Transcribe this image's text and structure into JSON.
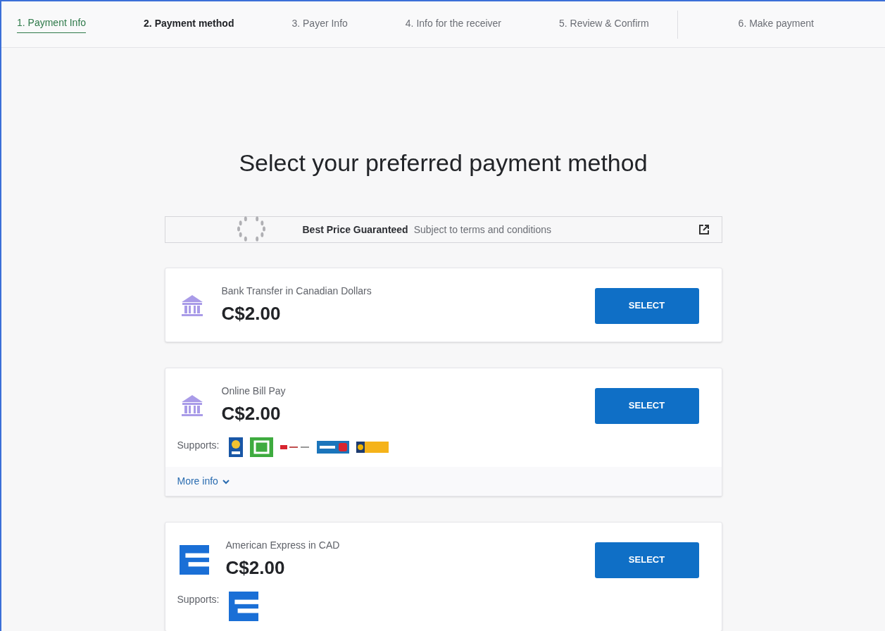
{
  "steps": [
    {
      "label": "1. Payment Info",
      "selected": false,
      "completed": true
    },
    {
      "label": "2. Payment method",
      "selected": true,
      "completed": false
    },
    {
      "label": "3. Payer Info",
      "selected": false,
      "completed": false
    },
    {
      "label": "4. Info for the receiver",
      "selected": false,
      "completed": false
    },
    {
      "label": "5. Review & Confirm",
      "selected": false,
      "completed": false
    },
    {
      "label": "6. Make payment",
      "selected": false,
      "completed": false
    }
  ],
  "title": "Select your preferred payment method",
  "banner": {
    "headline": "Best Price Guaranteed",
    "text": "Subject to terms and conditions"
  },
  "methods": [
    {
      "kind": "bank",
      "name": "Bank Transfer in Canadian Dollars",
      "price": "C$2.00",
      "button": "SELECT"
    },
    {
      "kind": "bank",
      "name": "Online Bill Pay",
      "price": "C$2.00",
      "button": "SELECT",
      "supports_label": "Supports:",
      "supports": [
        {
          "kind": "rbc"
        },
        {
          "kind": "td"
        },
        {
          "kind": "national"
        },
        {
          "kind": "bmo"
        },
        {
          "kind": "laurentian"
        }
      ],
      "more_info": {
        "label": "More info",
        "expanded": false
      }
    },
    {
      "kind": "card",
      "name": "American Express in CAD",
      "price": "C$2.00",
      "button": "SELECT",
      "supports_label": "Supports:",
      "supports": [
        {
          "kind": "amex"
        }
      ]
    }
  ]
}
